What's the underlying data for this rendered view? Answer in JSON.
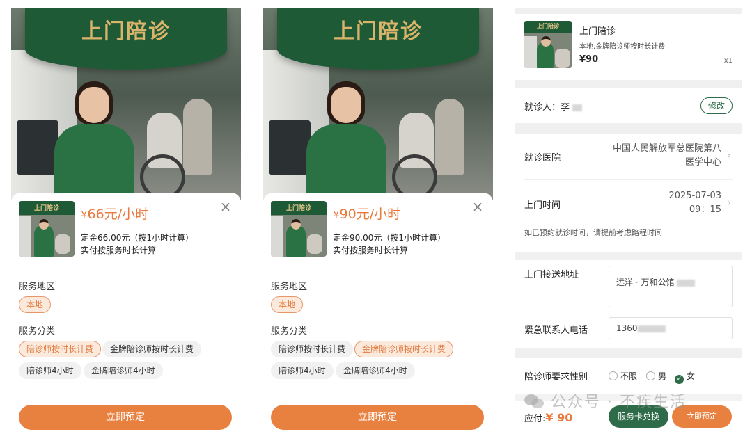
{
  "hero": {
    "banner": "上门陪诊"
  },
  "panels": [
    {
      "thumb_label": "上门陪诊",
      "currency": "¥",
      "price": "66元/小时",
      "deposit": "定金66.00元（按1小时计算）",
      "actual": "实付按服务时长计算",
      "region_label": "服务地区",
      "region_chip": "本地",
      "category_label": "服务分类",
      "chips": [
        "陪诊师按时长计费",
        "金牌陪诊师按时长计费",
        "陪诊师4小时",
        "金牌陪诊师4小时"
      ],
      "selected_chip": 0,
      "cta": "立即预定"
    },
    {
      "thumb_label": "上门陪诊",
      "currency": "¥",
      "price": "90元/小时",
      "deposit": "定金90.00元（按1小时计算）",
      "actual": "实付按服务时长计算",
      "region_label": "服务地区",
      "region_chip": "本地",
      "category_label": "服务分类",
      "chips": [
        "陪诊师按时长计费",
        "金牌陪诊师按时长计费",
        "陪诊师4小时",
        "金牌陪诊师4小时"
      ],
      "selected_chip": 1,
      "cta": "立即预定"
    }
  ],
  "order": {
    "thumb_label": "上门陪诊",
    "title": "上门陪诊",
    "subtitle": "本地,金牌陪诊师按时长计费",
    "price": "¥90",
    "qty": "x1",
    "patient_label": "就诊人：",
    "patient_name": "李",
    "edit": "修改",
    "hospital_label": "就诊医院",
    "hospital_value_1": "中国人民解放军总医院第八",
    "hospital_value_2": "医学中心",
    "time_label": "上门时间",
    "date": "2025-07-03",
    "time": "09：15",
    "time_hint": "如已预约就诊时间，请提前考虑路程时间",
    "address_label": "上门接送地址",
    "address_value": "远洋 · 万和公馆",
    "phone_label": "紧急联系人电话",
    "phone_value": "1360",
    "gender_label": "陪诊师要求性别",
    "gender_options": [
      "不限",
      "男",
      "女"
    ],
    "gender_selected": 2,
    "due_label": "应付:",
    "due_amount": "¥ 90",
    "redeem": "服务卡兑换",
    "book": "立即预定"
  },
  "watermark": "公众号 · 不疾生活"
}
